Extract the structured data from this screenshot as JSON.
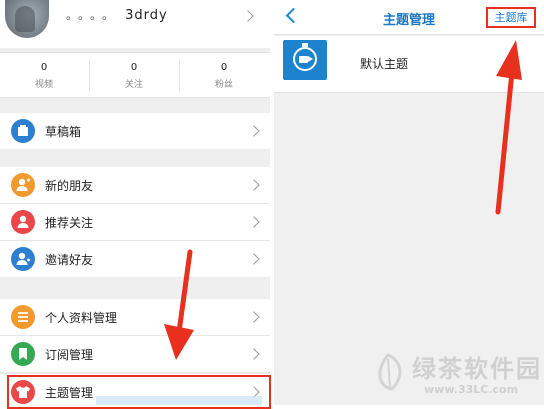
{
  "profile": {
    "dots": "。。。。",
    "username": "3drdy"
  },
  "stats": [
    {
      "value": "0",
      "label": "视频"
    },
    {
      "value": "0",
      "label": "关注"
    },
    {
      "value": "0",
      "label": "粉丝"
    }
  ],
  "menu": {
    "drafts": "草稿箱",
    "new_friends": "新的朋友",
    "recommended_follow": "推荐关注",
    "invite_friends": "邀请好友",
    "profile_management": "个人资料管理",
    "subscription_management": "订阅管理",
    "theme_management": "主题管理"
  },
  "theme_screen": {
    "title": "主题管理",
    "library_button": "主题库",
    "default_theme": "默认主题"
  },
  "watermark": {
    "text": "绿茶软件园",
    "url": "www.33LC.com"
  },
  "colors": {
    "accent_blue": "#1b78c4",
    "annotation_red": "#e8301f"
  }
}
